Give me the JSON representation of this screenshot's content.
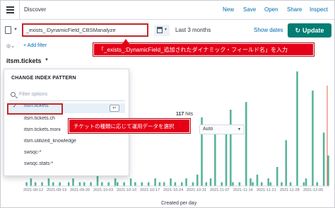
{
  "app": {
    "title": "Discover"
  },
  "top_links": [
    "New",
    "Save",
    "Open",
    "Share",
    "Inspect"
  ],
  "query": {
    "value": "_exists_:DynamicField_CBSManalyze",
    "date_range": "Last 3 months",
    "show_dates": "Show dates",
    "update_label": "Update"
  },
  "filter": {
    "add_label": "+ Add filter"
  },
  "index": {
    "current": "itsm.tickets",
    "panel_title": "CHANGE INDEX PATTERN",
    "search_placeholder": "Filter options",
    "options": [
      "itsm.tickets",
      "itsm.tickets.ch",
      "itsm.tickets.moni",
      "itsm.utilized_knowledge",
      "swsqc-*",
      "swsqc.stats-*"
    ],
    "selected_index": 0,
    "return_glyph": "↩"
  },
  "callouts": {
    "query_hint": "「_exists_:DynamicField_追加されたダイナミック・フィールド名」を入力",
    "index_hint": "チケットの種類に応じて運用データを選択"
  },
  "hits": {
    "count": "117",
    "suffix": "hits"
  },
  "interval": {
    "value": "Auto"
  },
  "chart_data": {
    "type": "bar",
    "xlabel": "Created per day",
    "x_ticks": [
      "2021-09-12",
      "2021-09-19",
      "2021-09-26",
      "2021-10-03",
      "2021-10-10",
      "2021-10-17",
      "2021-10-24",
      "2021-10-31",
      "2021-11-07",
      "2021-11-14",
      "2021-11-21",
      "2021-11-28",
      "2021-12-05"
    ],
    "bar_color": "#54b399",
    "marker_color": "#e7664c",
    "values": [
      1,
      0,
      2,
      0,
      1,
      0,
      0,
      1,
      0,
      0,
      2,
      0,
      1,
      0,
      0,
      1,
      0,
      0,
      0,
      1,
      0,
      2,
      0,
      0,
      1,
      0,
      1,
      0,
      0,
      1,
      0,
      0,
      3,
      0,
      1,
      0,
      0,
      1,
      0,
      0,
      2,
      1,
      0,
      0,
      1,
      0,
      0,
      2,
      0,
      1,
      0,
      0,
      1,
      0,
      0,
      1,
      0,
      0,
      2,
      0,
      1,
      0,
      1,
      0,
      0,
      2,
      0,
      1,
      0,
      0,
      1,
      0,
      2,
      0,
      0,
      1,
      0,
      3,
      0,
      18,
      0,
      1,
      0,
      2,
      0,
      16,
      0,
      0,
      1,
      0,
      14,
      0,
      20,
      1,
      0,
      0,
      1,
      0,
      0,
      22,
      0,
      2,
      1,
      0,
      3,
      0,
      1,
      0,
      0,
      2,
      1,
      0,
      0,
      5,
      0,
      1,
      0,
      12,
      0,
      1,
      0,
      0,
      30,
      0,
      0,
      1,
      2,
      0,
      0,
      25,
      0,
      1,
      0,
      0,
      14,
      0,
      8
    ]
  }
}
